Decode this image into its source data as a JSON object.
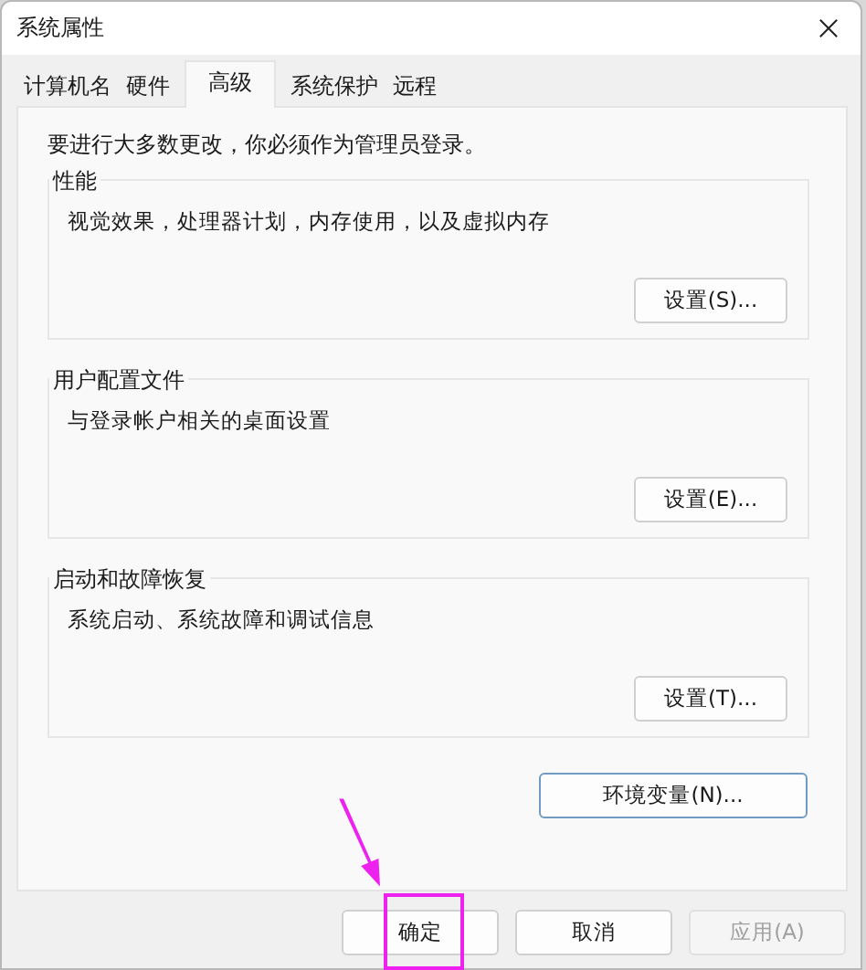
{
  "window": {
    "title": "系统属性"
  },
  "tabs": [
    {
      "label": "计算机名",
      "selected": false
    },
    {
      "label": "硬件",
      "selected": false
    },
    {
      "label": "高级",
      "selected": true
    },
    {
      "label": "系统保护",
      "selected": false
    },
    {
      "label": "远程",
      "selected": false
    }
  ],
  "notice": "要进行大多数更改，你必须作为管理员登录。",
  "groups": [
    {
      "title": "性能",
      "description": "视觉效果，处理器计划，内存使用，以及虚拟内存",
      "button": "设置(S)..."
    },
    {
      "title": "用户配置文件",
      "description": "与登录帐户相关的桌面设置",
      "button": "设置(E)..."
    },
    {
      "title": "启动和故障恢复",
      "description": "系统启动、系统故障和调试信息",
      "button": "设置(T)..."
    }
  ],
  "environment_button": {
    "label": "环境变量(N)...",
    "focused": true
  },
  "footer_buttons": [
    {
      "label": "确定",
      "disabled": false
    },
    {
      "label": "取消",
      "disabled": false
    },
    {
      "label": "应用(A)",
      "disabled": true
    }
  ]
}
